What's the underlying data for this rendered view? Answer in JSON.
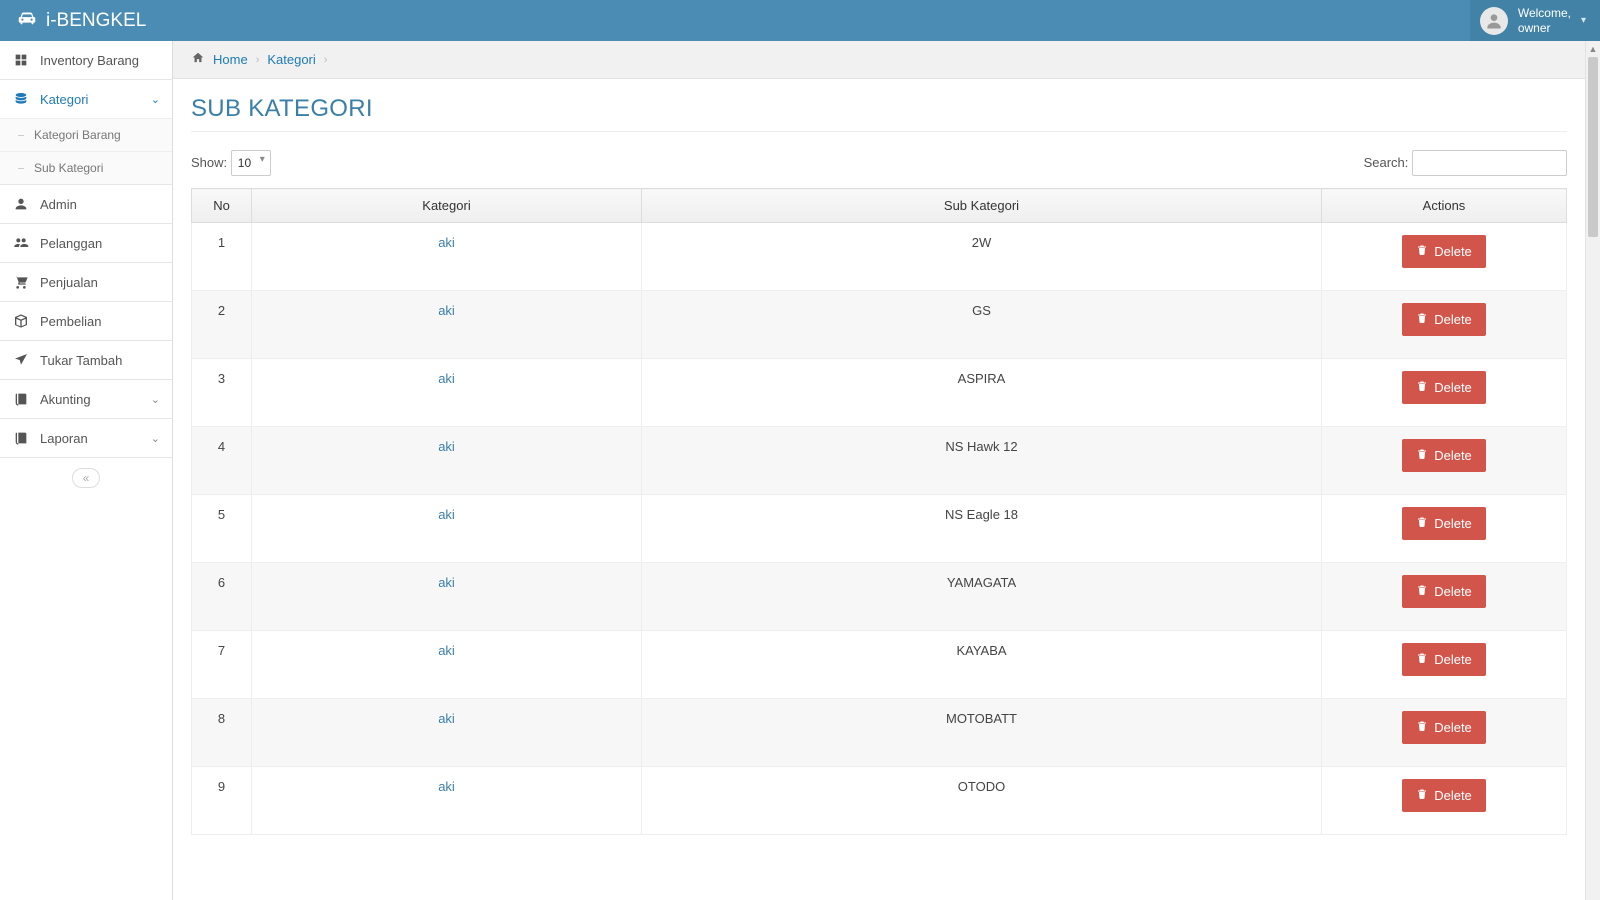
{
  "brand": "i-BENGKEL",
  "user": {
    "welcome": "Welcome,",
    "name": "owner"
  },
  "sidebar": {
    "items": [
      {
        "label": "Inventory Barang",
        "icon": "inventory"
      },
      {
        "label": "Kategori",
        "icon": "database",
        "active": true,
        "children": [
          {
            "label": "Kategori Barang"
          },
          {
            "label": "Sub Kategori"
          }
        ]
      },
      {
        "label": "Admin",
        "icon": "user"
      },
      {
        "label": "Pelanggan",
        "icon": "users"
      },
      {
        "label": "Penjualan",
        "icon": "cart"
      },
      {
        "label": "Pembelian",
        "icon": "box"
      },
      {
        "label": "Tukar Tambah",
        "icon": "plane"
      },
      {
        "label": "Akunting",
        "icon": "book",
        "chev": true
      },
      {
        "label": "Laporan",
        "icon": "book",
        "chev": true
      }
    ]
  },
  "breadcrumb": {
    "home": "Home",
    "cat": "Kategori"
  },
  "page": {
    "title": "SUB KATEGORI"
  },
  "table": {
    "show_label": "Show:",
    "show_value": "10",
    "search_label": "Search:",
    "headers": {
      "no": "No",
      "kategori": "Kategori",
      "sub": "Sub Kategori",
      "actions": "Actions"
    },
    "delete_label": "Delete",
    "rows": [
      {
        "no": "1",
        "kategori": "aki",
        "sub": "2W"
      },
      {
        "no": "2",
        "kategori": "aki",
        "sub": "GS"
      },
      {
        "no": "3",
        "kategori": "aki",
        "sub": "ASPIRA"
      },
      {
        "no": "4",
        "kategori": "aki",
        "sub": "NS Hawk 12"
      },
      {
        "no": "5",
        "kategori": "aki",
        "sub": "NS Eagle 18"
      },
      {
        "no": "6",
        "kategori": "aki",
        "sub": "YAMAGATA"
      },
      {
        "no": "7",
        "kategori": "aki",
        "sub": "KAYABA"
      },
      {
        "no": "8",
        "kategori": "aki",
        "sub": "MOTOBATT"
      },
      {
        "no": "9",
        "kategori": "aki",
        "sub": "OTODO"
      }
    ]
  }
}
